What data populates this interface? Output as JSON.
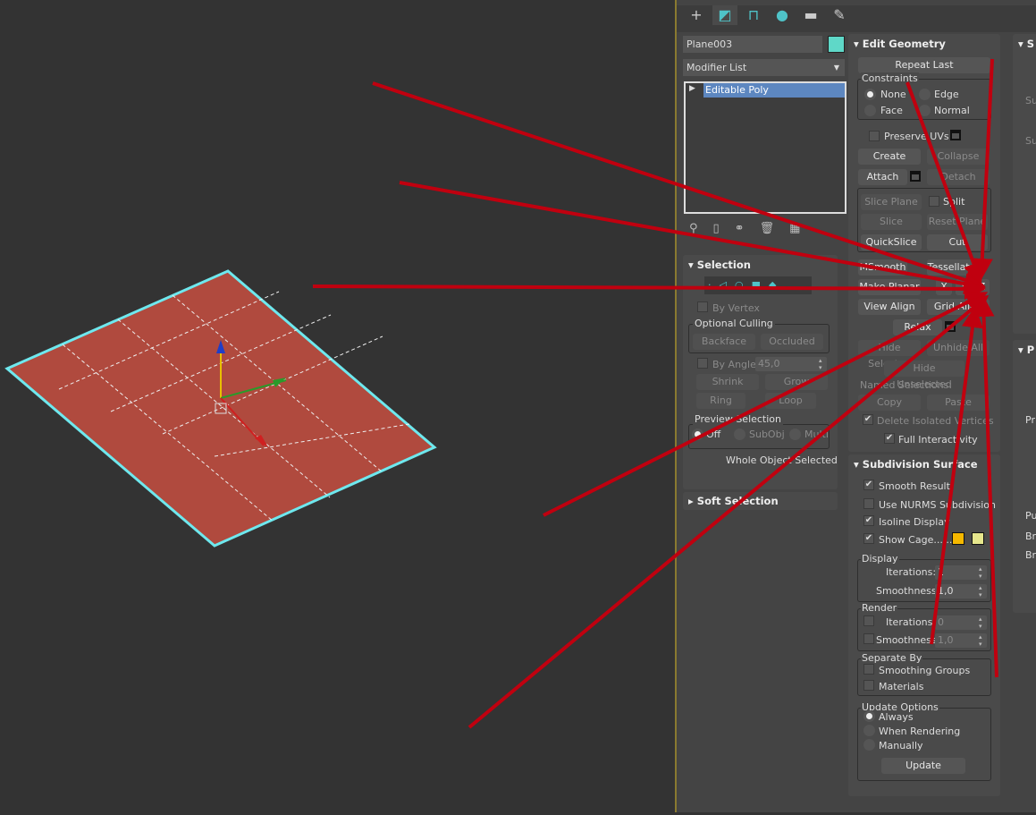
{
  "object": {
    "name": "Plane003",
    "color": "#5fd8c8"
  },
  "modifier_list": {
    "label": "Modifier List",
    "items": [
      "Editable Poly"
    ]
  },
  "tabs": [
    "create",
    "modify",
    "hierarchy",
    "motion",
    "display",
    "utilities"
  ],
  "selection": {
    "title": "Selection",
    "by_vertex": "By Vertex",
    "optional_culling": "Optional Culling",
    "backface": "Backface",
    "occluded": "Occluded",
    "by_angle": "By Angle:",
    "angle_value": "45,0",
    "shrink": "Shrink",
    "grow": "Grow",
    "ring": "Ring",
    "loop": "Loop",
    "preview_selection": "Preview Selection",
    "preview_off": "Off",
    "preview_subobj": "SubObj",
    "preview_multi": "Multi",
    "status": "Whole Object Selected"
  },
  "soft_selection": {
    "title": "Soft Selection"
  },
  "edit_geometry": {
    "title": "Edit Geometry",
    "repeat_last": "Repeat Last",
    "constraints": "Constraints",
    "none": "None",
    "edge": "Edge",
    "face": "Face",
    "normal": "Normal",
    "preserve_uvs": "Preserve UVs",
    "create": "Create",
    "collapse": "Collapse",
    "attach": "Attach",
    "detach": "Detach",
    "slice_plane": "Slice Plane",
    "split": "Split",
    "slice": "Slice",
    "reset_plane": "Reset Plane",
    "quickslice": "QuickSlice",
    "cut": "Cut",
    "msmooth": "MSmooth",
    "tessellate": "Tessellate",
    "make_planar": "Make Planar",
    "x": "X",
    "y": "Y",
    "z": "Z",
    "view_align": "View Align",
    "grid_align": "Grid Align",
    "relax": "Relax",
    "hide_selected": "Hide Selected",
    "unhide_all": "Unhide All",
    "hide_unselected": "Hide Unselected",
    "named_selections": "Named Selections:",
    "copy": "Copy",
    "paste": "Paste",
    "delete_isolated": "Delete Isolated Vertices",
    "full_interactivity": "Full Interactivity"
  },
  "subdivision_surface": {
    "title": "Subdivision Surface",
    "smooth_result": "Smooth Result",
    "use_nurms": "Use NURMS Subdivision",
    "isoline_display": "Isoline Display",
    "show_cage": "Show Cage......",
    "cage_color_1": "#f5b800",
    "cage_color_2": "#e6e68c",
    "display": "Display",
    "iterations": "Iterations:",
    "display_iterations": "1",
    "smoothness": "Smoothness:",
    "display_smoothness": "1,0",
    "render": "Render",
    "render_iterations": "0",
    "render_smoothness": "1,0",
    "separate_by": "Separate By",
    "smoothing_groups": "Smoothing Groups",
    "materials": "Materials",
    "update_options": "Update Options",
    "always": "Always",
    "when_rendering": "When Rendering",
    "manually": "Manually",
    "update": "Update"
  },
  "right_column": {
    "title_1": "S",
    "title_2": "P",
    "label_su1": "Su",
    "label_su2": "Su",
    "label_pr": "Pr",
    "label_pu": "Pu",
    "label_br1": "Br",
    "label_br2": "Br"
  },
  "colors": {
    "plane": "#b04a3e",
    "outline": "#6ee8ee",
    "arrow": "#c0000f"
  }
}
